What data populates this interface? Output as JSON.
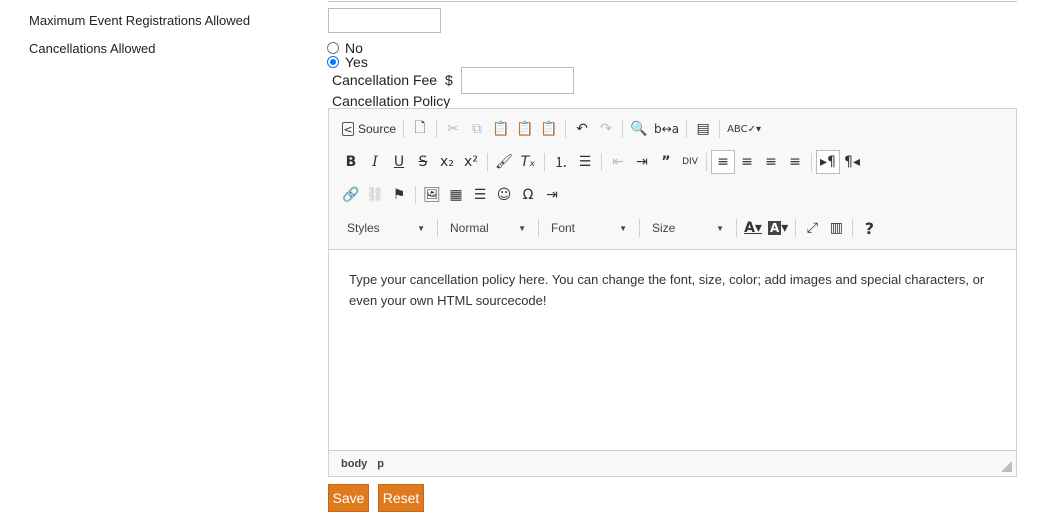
{
  "fields": {
    "max_registrations_label": "Maximum Event Registrations Allowed",
    "max_registrations_value": "",
    "cancellations_label": "Cancellations Allowed",
    "option_no": "No",
    "option_yes": "Yes",
    "selected_option": "Yes",
    "cancellation_fee_label": "Cancellation Fee",
    "currency_symbol": "$",
    "cancellation_fee_value": "",
    "cancellation_policy_label": "Cancellation Policy"
  },
  "editor": {
    "toolbar": {
      "source_label": "Source",
      "styles_label": "Styles",
      "format_label": "Normal",
      "font_label": "Font",
      "size_label": "Size",
      "help_label": "?"
    },
    "content_text": "Type your cancellation policy here. You can change the font, size, color; add images and special characters, or even your own HTML sourcecode!",
    "path": [
      "body",
      "p"
    ]
  },
  "actions": {
    "save_label": "Save",
    "reset_label": "Reset"
  },
  "colors": {
    "button_orange": "#e07a1f",
    "radio_blue": "#0075ff"
  }
}
